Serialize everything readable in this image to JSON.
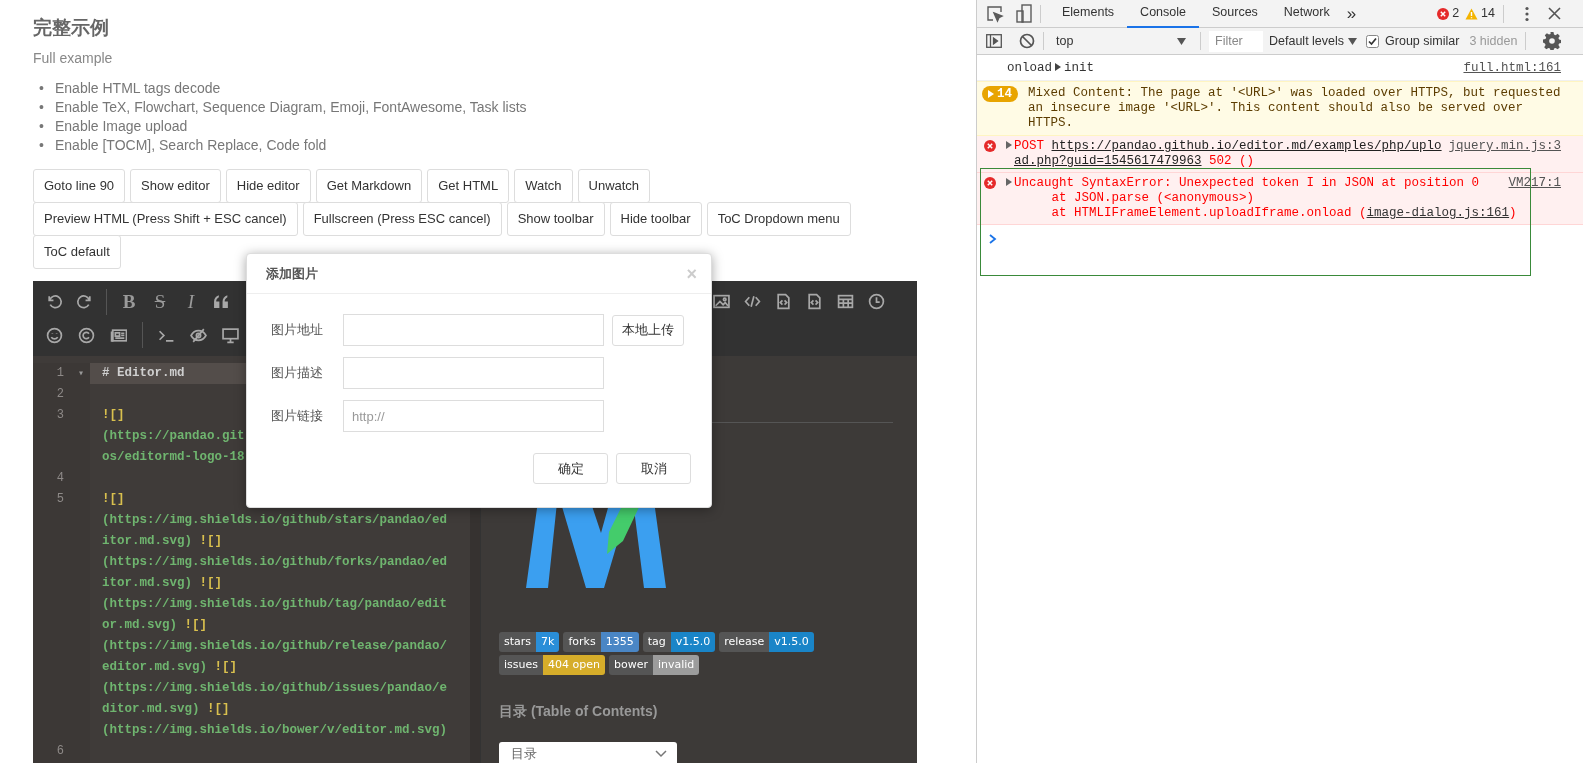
{
  "page": {
    "title": "完整示例",
    "subtitle": "Full example",
    "features": [
      {
        "marker": "•",
        "text": "Enable HTML tags decode"
      },
      {
        "marker": "•",
        "text": "Enable TeX, Flowchart, Sequence Diagram, Emoji, FontAwesome, Task lists"
      },
      {
        "marker": "•",
        "text": "Enable Image upload"
      },
      {
        "marker": "•",
        "text": "Enable [TOCM], Search Replace, Code fold"
      }
    ],
    "button_rows": [
      [
        "Goto line 90",
        "Show editor",
        "Hide editor",
        "Get Markdown",
        "Get HTML",
        "Watch",
        "Unwatch"
      ],
      [
        "Preview HTML (Press Shift + ESC cancel)",
        "Fullscreen (Press ESC cancel)",
        "Show toolbar",
        "Hide toolbar",
        "ToC Dropdown menu"
      ],
      [
        "ToC default"
      ]
    ]
  },
  "editor": {
    "format_glyphs": [
      {
        "kind": "bold",
        "text": "B"
      },
      {
        "kind": "strikethrough",
        "text": "S"
      },
      {
        "kind": "italic",
        "text": "I"
      }
    ],
    "lines": [
      {
        "number": "1",
        "fold_marker": "▾",
        "active": true,
        "rows": [
          [
            {
              "kind": "heading",
              "text": "# Editor.md"
            }
          ]
        ]
      },
      {
        "number": "2",
        "active": false,
        "rows": [
          []
        ]
      },
      {
        "number": "3",
        "active": false,
        "rows": [
          [
            {
              "kind": "image_mark",
              "text": "![]"
            }
          ],
          [
            {
              "kind": "url",
              "text": "(https://pandao.git"
            }
          ],
          [
            {
              "kind": "url",
              "text": "os/editormd-logo-18"
            }
          ]
        ]
      },
      {
        "number": "4",
        "active": false,
        "rows": [
          []
        ]
      },
      {
        "number": "5",
        "active": false,
        "rows": [
          [
            {
              "kind": "image_mark",
              "text": "![]"
            }
          ],
          [
            {
              "kind": "url",
              "text": "(https://img.shields.io/github/stars/pandao/ed"
            }
          ],
          [
            {
              "kind": "url",
              "text": "itor.md.svg) "
            },
            {
              "kind": "image_mark",
              "text": "![]"
            }
          ],
          [
            {
              "kind": "url",
              "text": "(https://img.shields.io/github/forks/pandao/ed"
            }
          ],
          [
            {
              "kind": "url",
              "text": "itor.md.svg) "
            },
            {
              "kind": "image_mark",
              "text": "![]"
            }
          ],
          [
            {
              "kind": "url",
              "text": "(https://img.shields.io/github/tag/pandao/edit"
            }
          ],
          [
            {
              "kind": "url",
              "text": "or.md.svg) "
            },
            {
              "kind": "image_mark",
              "text": "![]"
            }
          ],
          [
            {
              "kind": "url",
              "text": "(https://img.shields.io/github/release/pandao/"
            }
          ],
          [
            {
              "kind": "url",
              "text": "editor.md.svg) "
            },
            {
              "kind": "image_mark",
              "text": "![]"
            }
          ],
          [
            {
              "kind": "url",
              "text": "(https://img.shields.io/github/issues/pandao/e"
            }
          ],
          [
            {
              "kind": "url",
              "text": "ditor.md.svg) "
            },
            {
              "kind": "image_mark",
              "text": "![]"
            }
          ],
          [
            {
              "kind": "url",
              "text": "(https://img.shields.io/bower/v/editor.md.svg)"
            }
          ]
        ]
      },
      {
        "number": "6",
        "active": false,
        "rows": [
          []
        ]
      }
    ],
    "preview": {
      "badge_rows": [
        [
          {
            "label": "stars",
            "value": "7k",
            "color": "#2a8ed8"
          },
          {
            "label": "forks",
            "value": "1355",
            "color": "#4a86c5"
          },
          {
            "label": "tag",
            "value": "v1.5.0",
            "color": "#1a85c8"
          },
          {
            "label": "release",
            "value": "v1.5.0",
            "color": "#1a85c8"
          }
        ],
        [
          {
            "label": "issues",
            "value": "404 open",
            "color": "#d6ad2a"
          },
          {
            "label": "bower",
            "value": "invalid",
            "color": "#9c9c9c"
          }
        ]
      ],
      "toc_heading": "目录 (Table of Contents)",
      "toc_dropdown": "目录"
    }
  },
  "dialog": {
    "title": "添加图片",
    "close": "×",
    "fields": [
      {
        "label": "图片地址",
        "action": "本地上传"
      },
      {
        "label": "图片描述"
      },
      {
        "label": "图片链接",
        "placeholder": "http://"
      }
    ],
    "buttons": [
      "确定",
      "取消"
    ]
  },
  "devtools": {
    "tabs": [
      {
        "label": "Elements",
        "selected": false
      },
      {
        "label": "Console",
        "selected": true
      },
      {
        "label": "Sources",
        "selected": false
      },
      {
        "label": "Network",
        "selected": false
      }
    ],
    "more_tabs": "»",
    "error_count": "2",
    "warning_count": "14",
    "context": "top",
    "filter_placeholder": "Filter",
    "levels": "Default levels",
    "group_similar": {
      "label": "Group similar",
      "checked": true
    },
    "hidden": "3 hidden",
    "messages": [
      {
        "kind": "log",
        "text": "onload",
        "detail": "init",
        "source": "full.html:161"
      },
      {
        "kind": "warning",
        "repeat": "14",
        "text": "Mixed Content: The page at '<URL>' was loaded over HTTPS, but requested an insecure image '<URL>'. This content should also be served over HTTPS."
      },
      {
        "kind": "error",
        "method": "POST",
        "url": "https://pandao.github.io/editor.md/examples/php/upload.php?guid=1545617479963",
        "status": "502 ()",
        "source": "jquery.min.js:3"
      },
      {
        "kind": "error",
        "text": "Uncaught SyntaxError: Unexpected token I in JSON at position 0",
        "source": "VM217:1",
        "highlighted": true,
        "stack": [
          {
            "text": "at JSON.parse (<anonymous>)"
          },
          {
            "text": "at HTMLIFrameElement.uploadIframe.onload (",
            "link": "image-dialog.js:161",
            "after": ")"
          }
        ]
      }
    ]
  }
}
